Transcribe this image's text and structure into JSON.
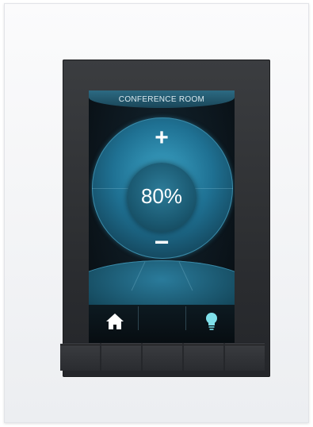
{
  "device": {
    "room_title": "CONFERENCE ROOM",
    "dimmer": {
      "level_text": "80%",
      "level_percent": 80,
      "increase_symbol": "+",
      "decrease_symbol": "−"
    },
    "nav": {
      "home_icon": "home-icon",
      "light_icon": "lightbulb-icon"
    },
    "hardware_keys_count": 5,
    "colors": {
      "accent": "#2a8fb5",
      "bulb": "#7fe0ea"
    }
  }
}
